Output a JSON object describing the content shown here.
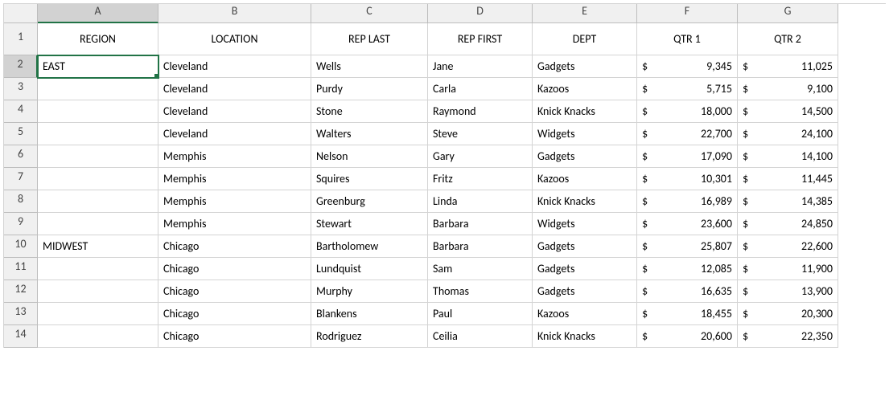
{
  "chart_data": {
    "type": "table",
    "columns": [
      "REGION",
      "LOCATION",
      "REP LAST",
      "REP FIRST",
      "DEPT",
      "QTR 1",
      "QTR 2"
    ],
    "rows": [
      [
        "EAST",
        "Cleveland",
        "Wells",
        "Jane",
        "Gadgets",
        9345,
        11025
      ],
      [
        "",
        "Cleveland",
        "Purdy",
        "Carla",
        "Kazoos",
        5715,
        9100
      ],
      [
        "",
        "Cleveland",
        "Stone",
        "Raymond",
        "Knick Knacks",
        18000,
        14500
      ],
      [
        "",
        "Cleveland",
        "Walters",
        "Steve",
        "Widgets",
        22700,
        24100
      ],
      [
        "",
        "Memphis",
        "Nelson",
        "Gary",
        "Gadgets",
        17090,
        14100
      ],
      [
        "",
        "Memphis",
        "Squires",
        "Fritz",
        "Kazoos",
        10301,
        11445
      ],
      [
        "",
        "Memphis",
        "Greenburg",
        "Linda",
        "Knick Knacks",
        16989,
        14385
      ],
      [
        "",
        "Memphis",
        "Stewart",
        "Barbara",
        "Widgets",
        23600,
        24850
      ],
      [
        "MIDWEST",
        "Chicago",
        "Bartholomew",
        "Barbara",
        "Gadgets",
        25807,
        22600
      ],
      [
        "",
        "Chicago",
        "Lundquist",
        "Sam",
        "Gadgets",
        12085,
        11900
      ],
      [
        "",
        "Chicago",
        "Murphy",
        "Thomas",
        "Gadgets",
        16635,
        13900
      ],
      [
        "",
        "Chicago",
        "Blankens",
        "Paul",
        "Kazoos",
        18455,
        20300
      ],
      [
        "",
        "Chicago",
        "Rodriguez",
        "Ceilia",
        "Knick Knacks",
        20600,
        22350
      ]
    ]
  },
  "col_letters": [
    "A",
    "B",
    "C",
    "D",
    "E",
    "F",
    "G"
  ],
  "row_numbers": [
    "1",
    "2",
    "3",
    "4",
    "5",
    "6",
    "7",
    "8",
    "9",
    "10",
    "11",
    "12",
    "13",
    "14"
  ],
  "headers": {
    "region": "REGION",
    "location": "LOCATION",
    "replast": "REP LAST",
    "repfirst": "REP FIRST",
    "dept": "DEPT",
    "qtr1": "QTR 1",
    "qtr2": "QTR 2"
  },
  "currency_symbol": "$",
  "rows": [
    {
      "region": "EAST",
      "location": "Cleveland",
      "last": "Wells",
      "first": "Jane",
      "dept": "Gadgets",
      "q1": "9,345",
      "q2": "11,025"
    },
    {
      "region": "",
      "location": "Cleveland",
      "last": "Purdy",
      "first": "Carla",
      "dept": "Kazoos",
      "q1": "5,715",
      "q2": "9,100"
    },
    {
      "region": "",
      "location": "Cleveland",
      "last": "Stone",
      "first": "Raymond",
      "dept": "Knick Knacks",
      "q1": "18,000",
      "q2": "14,500"
    },
    {
      "region": "",
      "location": "Cleveland",
      "last": "Walters",
      "first": "Steve",
      "dept": "Widgets",
      "q1": "22,700",
      "q2": "24,100"
    },
    {
      "region": "",
      "location": "Memphis",
      "last": "Nelson",
      "first": "Gary",
      "dept": "Gadgets",
      "q1": "17,090",
      "q2": "14,100"
    },
    {
      "region": "",
      "location": "Memphis",
      "last": "Squires",
      "first": "Fritz",
      "dept": "Kazoos",
      "q1": "10,301",
      "q2": "11,445"
    },
    {
      "region": "",
      "location": "Memphis",
      "last": "Greenburg",
      "first": "Linda",
      "dept": "Knick Knacks",
      "q1": "16,989",
      "q2": "14,385"
    },
    {
      "region": "",
      "location": "Memphis",
      "last": "Stewart",
      "first": "Barbara",
      "dept": "Widgets",
      "q1": "23,600",
      "q2": "24,850"
    },
    {
      "region": "MIDWEST",
      "location": "Chicago",
      "last": "Bartholomew",
      "first": "Barbara",
      "dept": "Gadgets",
      "q1": "25,807",
      "q2": "22,600"
    },
    {
      "region": "",
      "location": "Chicago",
      "last": "Lundquist",
      "first": "Sam",
      "dept": "Gadgets",
      "q1": "12,085",
      "q2": "11,900"
    },
    {
      "region": "",
      "location": "Chicago",
      "last": "Murphy",
      "first": "Thomas",
      "dept": "Gadgets",
      "q1": "16,635",
      "q2": "13,900"
    },
    {
      "region": "",
      "location": "Chicago",
      "last": "Blankens",
      "first": "Paul",
      "dept": "Kazoos",
      "q1": "18,455",
      "q2": "20,300"
    },
    {
      "region": "",
      "location": "Chicago",
      "last": "Rodriguez",
      "first": "Ceilia",
      "dept": "Knick Knacks",
      "q1": "20,600",
      "q2": "22,350"
    }
  ],
  "selected_cell": "A2"
}
